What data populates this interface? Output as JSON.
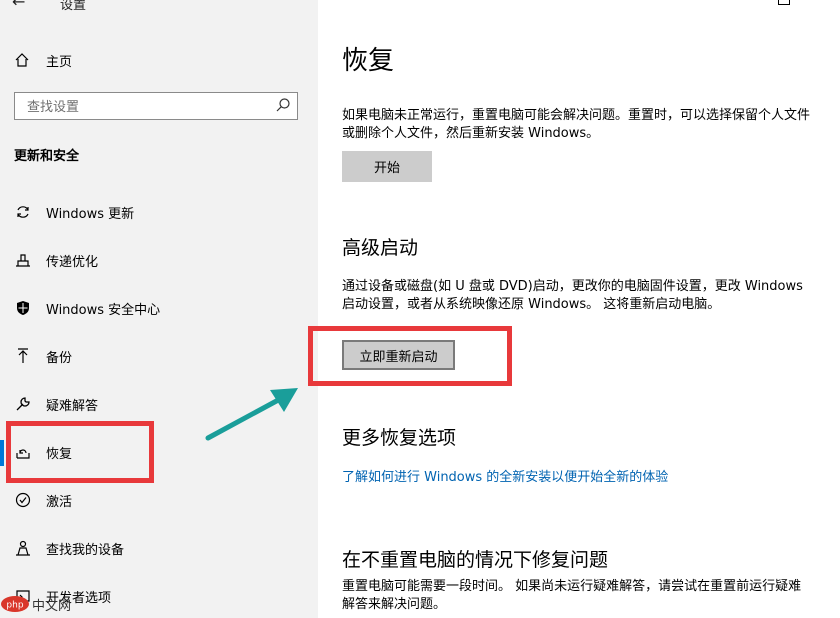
{
  "window": {
    "title": "设置"
  },
  "sidebar": {
    "home_label": "主页",
    "search_placeholder": "查找设置",
    "section_title": "更新和安全",
    "items": [
      {
        "label": "Windows 更新",
        "icon": "sync-icon"
      },
      {
        "label": "传递优化",
        "icon": "delivery-optimization-icon"
      },
      {
        "label": "Windows 安全中心",
        "icon": "shield-icon"
      },
      {
        "label": "备份",
        "icon": "backup-arrow-icon"
      },
      {
        "label": "疑难解答",
        "icon": "wrench-icon"
      },
      {
        "label": "恢复",
        "icon": "recovery-icon",
        "selected": true
      },
      {
        "label": "激活",
        "icon": "check-circle-icon"
      },
      {
        "label": "查找我的设备",
        "icon": "person-location-icon"
      },
      {
        "label": "开发者选项",
        "icon": "developer-icon"
      }
    ]
  },
  "main": {
    "title": "恢复",
    "reset": {
      "desc": "如果电脑未正常运行，重置电脑可能会解决问题。重置时，可以选择保留个人文件或删除个人文件，然后重新安装 Windows。",
      "button": "开始"
    },
    "advanced": {
      "heading": "高级启动",
      "desc": "通过设备或磁盘(如 U 盘或 DVD)启动，更改你的电脑固件设置，更改 Windows 启动设置，或者从系统映像还原 Windows。 这将重新启动电脑。",
      "button": "立即重新启动"
    },
    "more": {
      "heading": "更多恢复选项",
      "link": "了解如何进行 Windows 的全新安装以便开始全新的体验"
    },
    "fix": {
      "heading": "在不重置电脑的情况下修复问题",
      "desc": "重置电脑可能需要一段时间。 如果尚未运行疑难解答，请尝试在重置前运行疑难解答来解决问题。"
    }
  },
  "annotations": {
    "highlight_color": "#e8393b",
    "arrow_color": "#1a9e9a"
  },
  "watermark": {
    "text": "中文网",
    "logo": "php"
  },
  "colors": {
    "accent": "#0078d7",
    "link": "#0063b1",
    "sidebar_bg": "#f2f2f2",
    "button_bg": "#cccccc"
  }
}
